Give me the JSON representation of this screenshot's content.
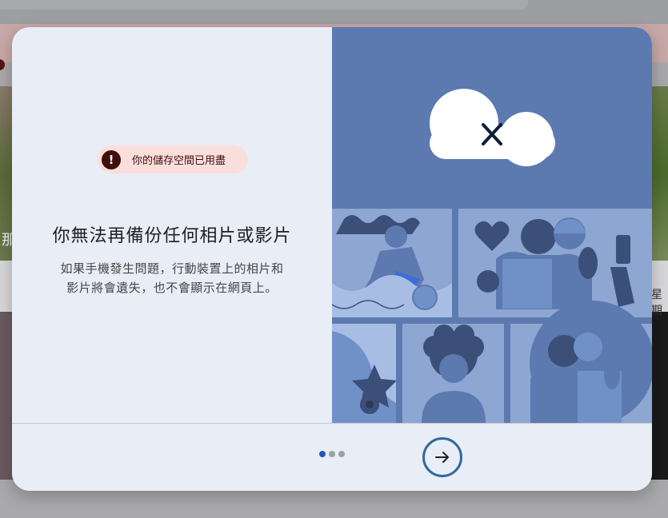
{
  "background": {
    "left_fragment": "那",
    "right_fragment": "星期"
  },
  "dialog": {
    "warning_chip": {
      "icon": "exclamation-icon",
      "text": "你的儲存空間已用盡"
    },
    "title": "你無法再備份任何相片或影片",
    "body": "如果手機發生問題，行動裝置上的相片和影片將會遺失，也不會顯示在網頁上。",
    "illustration": {
      "cloud_icon": "cloud-off-icon",
      "panels": [
        "runner-with-ball",
        "friends-selfie",
        "star-shape",
        "child-portrait",
        "couple-hug"
      ]
    },
    "pagination": {
      "total": 3,
      "current": 1
    },
    "next_button": {
      "icon": "arrow-right-icon"
    },
    "colors": {
      "accent": "#1a5ab8",
      "warning_bg": "#f9dedc",
      "warning_fg": "#410e0b",
      "illustration_bg": "#5c7ab0"
    }
  }
}
